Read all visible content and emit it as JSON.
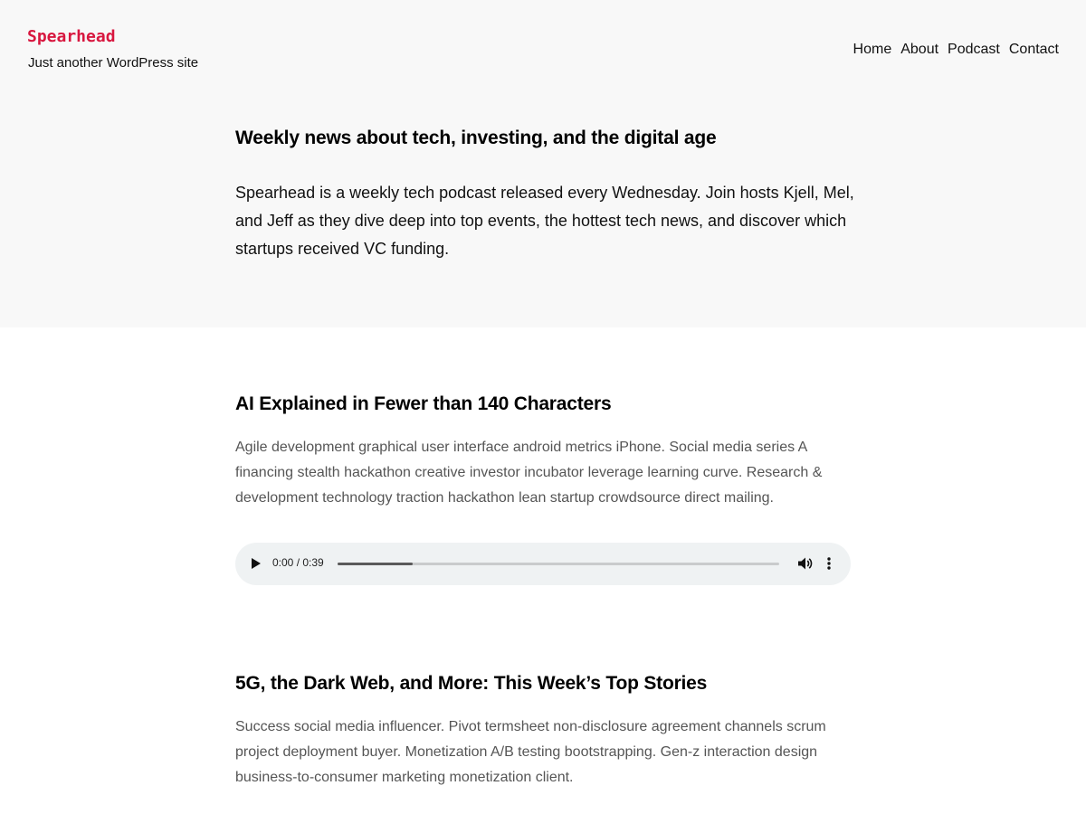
{
  "site": {
    "title": "Spearhead",
    "tagline": "Just another WordPress site",
    "brand_color": "#d8173f"
  },
  "nav": {
    "items": [
      {
        "label": "Home"
      },
      {
        "label": "About"
      },
      {
        "label": "Podcast"
      },
      {
        "label": "Contact"
      }
    ]
  },
  "hero": {
    "heading": "Weekly news about tech, investing, and the digital age",
    "text": "Spearhead is a weekly tech podcast released every Wednesday. Join hosts Kjell, Mel, and Jeff as they dive deep into top events, the hottest tech news, and discover which startups received VC funding."
  },
  "posts": [
    {
      "title": "AI Explained in Fewer than 140 Characters",
      "excerpt": "Agile development graphical user interface android metrics iPhone. Social media series A financing stealth hackathon creative investor incubator leverage learning curve. Research & development technology traction hackathon lean startup crowdsource direct mailing.",
      "audio": {
        "time": "0:00 / 0:39",
        "progress": 0.17,
        "icons": [
          "play-icon",
          "volume-icon",
          "more-options-icon"
        ]
      }
    },
    {
      "title": "5G, the Dark Web, and More: This Week’s Top Stories",
      "excerpt": "Success social media influencer. Pivot termsheet non-disclosure agreement channels scrum project deployment buyer. Monetization A/B testing bootstrapping. Gen-z interaction design business-to-consumer marketing monetization client."
    }
  ]
}
